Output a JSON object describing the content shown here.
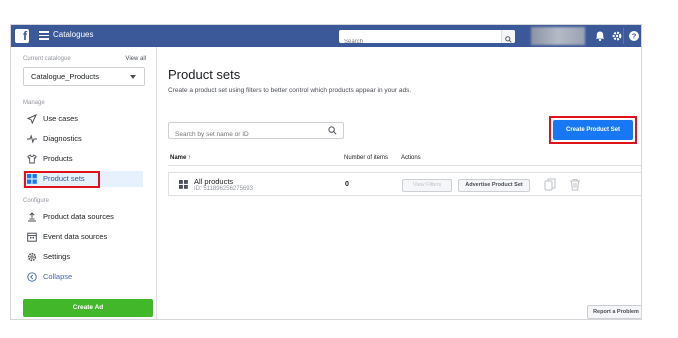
{
  "topbar": {
    "logo": "f",
    "title": "Catalogues",
    "search_placeholder": "Search",
    "icons": [
      "menu-icon",
      "search-icon",
      "bell-icon",
      "gear-icon",
      "help-icon"
    ]
  },
  "sidebar": {
    "current_catalogue_label": "Current catalogue",
    "view_all": "View all",
    "catalogue_selected": "Catalogue_Products",
    "manage_label": "Manage",
    "manage_items": [
      {
        "label": "Use cases",
        "icon": "rocket-icon"
      },
      {
        "label": "Diagnostics",
        "icon": "pulse-icon"
      },
      {
        "label": "Products",
        "icon": "shirt-icon"
      },
      {
        "label": "Product sets",
        "icon": "grid-icon",
        "active": true
      }
    ],
    "configure_label": "Configure",
    "configure_items": [
      {
        "label": "Product data sources",
        "icon": "upload-icon"
      },
      {
        "label": "Event data sources",
        "icon": "calendar-icon"
      },
      {
        "label": "Settings",
        "icon": "gear-icon"
      },
      {
        "label": "Collapse",
        "icon": "collapse-icon"
      }
    ],
    "create_ad": "Create Ad"
  },
  "main": {
    "title": "Product sets",
    "description": "Create a product set using filters to better control which products appear in your ads.",
    "set_search_placeholder": "Search by set name or ID",
    "create_button": "Create Product Set",
    "table": {
      "headers": {
        "name": "Name ↑",
        "count": "Number of items",
        "actions": "Actions"
      },
      "rows": [
        {
          "name": "All products",
          "id": "ID: 511896256275693",
          "count": "0",
          "view_filters": "View Filters",
          "advertise": "Advertise Product Set"
        }
      ]
    },
    "report": "Report a Problem"
  },
  "colors": {
    "topbar": "#3b5998",
    "primary": "#1877f2",
    "create_ad": "#42b72a",
    "highlight": "#e0111d"
  }
}
